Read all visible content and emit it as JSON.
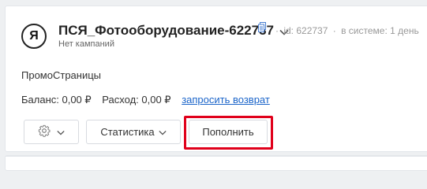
{
  "account": {
    "logo_letter": "Я",
    "name": "ПСЯ_Фотооборудование-622737",
    "id_text": "id: 622737",
    "in_system_text": "в системе: 1 день",
    "separator": "·",
    "campaigns_status": "Нет кампаний"
  },
  "section_label": "ПромоСтраницы",
  "finance": {
    "balance": "Баланс: 0,00 ₽",
    "expense": "Расход: 0,00 ₽",
    "refund_link": "запросить возврат"
  },
  "actions": {
    "statistics_label": "Статистика",
    "topup_label": "Пополнить"
  },
  "colors": {
    "link": "#1a64c9",
    "highlight": "#e0001b"
  },
  "icons": {
    "logo": "yandex-logo",
    "account_menu": "chevron-down-icon",
    "copy": "copy-icon",
    "settings": "gear-icon"
  }
}
